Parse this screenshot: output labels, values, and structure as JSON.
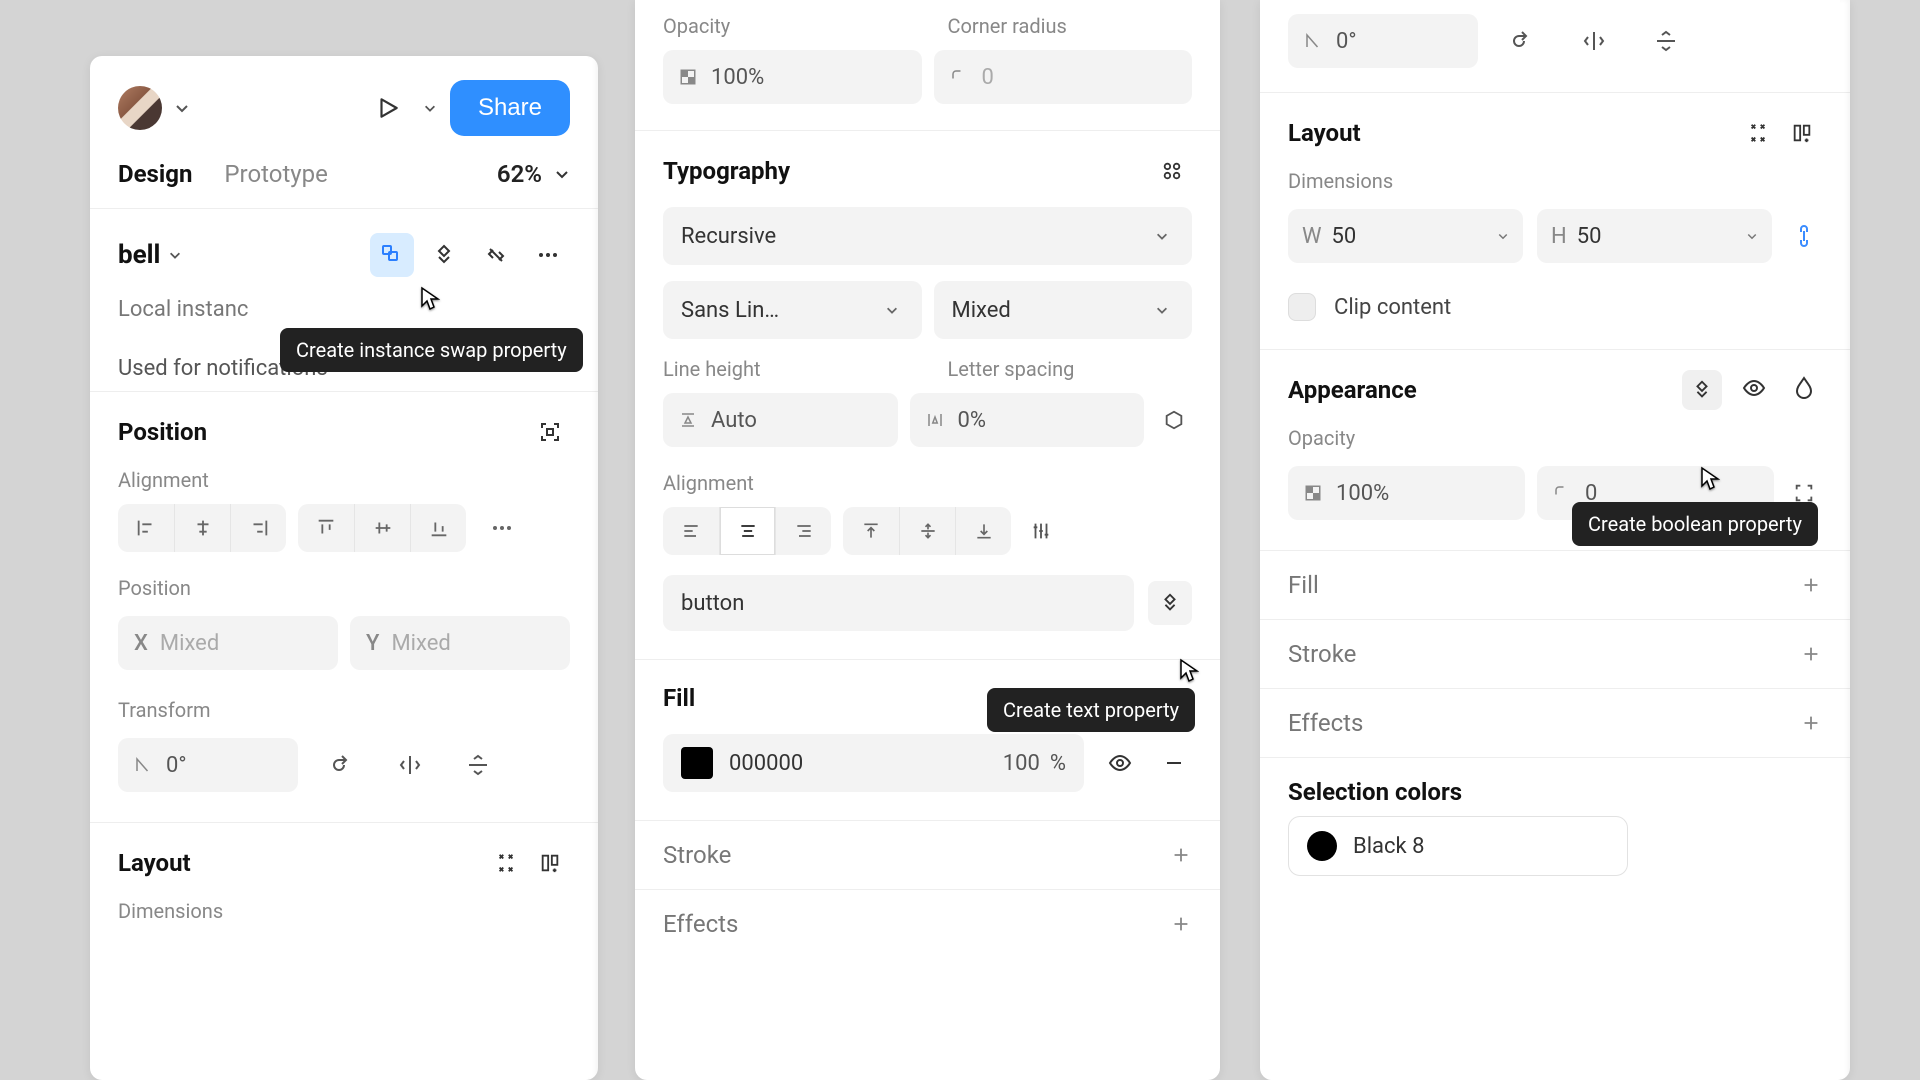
{
  "panel1": {
    "share": "Share",
    "tabs": {
      "design": "Design",
      "prototype": "Prototype"
    },
    "zoom": "62%",
    "element_name": "bell",
    "local_instance": "Local instanc",
    "used_for": "Used for notifications",
    "position_title": "Position",
    "alignment_label": "Alignment",
    "position_label": "Position",
    "x_prefix": "X",
    "x_value": "Mixed",
    "y_prefix": "Y",
    "y_value": "Mixed",
    "transform_label": "Transform",
    "rotation": "0°",
    "layout_title": "Layout",
    "dimensions_label": "Dimensions",
    "tooltip": "Create instance swap property"
  },
  "panel2": {
    "opacity_label": "Opacity",
    "opacity_value": "100%",
    "corner_label": "Corner radius",
    "corner_value": "0",
    "typography_title": "Typography",
    "font_family": "Recursive",
    "font_style": "Sans Lin…",
    "font_size": "Mixed",
    "line_height_label": "Line height",
    "line_height_value": "Auto",
    "letter_spacing_label": "Letter spacing",
    "letter_spacing_value": "0%",
    "alignment_label": "Alignment",
    "text_value": "button",
    "tooltip": "Create text property",
    "fill_title": "Fill",
    "fill_hex": "000000",
    "fill_pct": "100",
    "fill_unit": "%",
    "stroke_title": "Stroke",
    "effects_title": "Effects"
  },
  "panel3": {
    "rotation": "0°",
    "layout_title": "Layout",
    "dimensions_label": "Dimensions",
    "w_prefix": "W",
    "w_value": "50",
    "h_prefix": "H",
    "h_value": "50",
    "clip_content": "Clip content",
    "appearance_title": "Appearance",
    "tooltip": "Create boolean property",
    "opacity_label": "Opacity",
    "opacity_value": "100%",
    "corner_value": "0",
    "fill_title": "Fill",
    "stroke_title": "Stroke",
    "effects_title": "Effects",
    "selection_title": "Selection colors",
    "selection_color": "Black 8"
  }
}
